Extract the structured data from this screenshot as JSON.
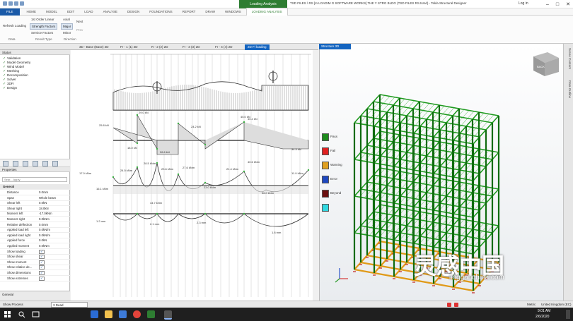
{
  "titlebar": {
    "context_tab": "Loading Analysis",
    "title": "TSD FILES \\ RS [In LOADIM G SOFTWARE WORKS] THE Y STRG BLDG (TSD FILES RS.tsmd) - Tekla Structural Designer",
    "login": "Log in",
    "minimize": "–",
    "maximize": "□",
    "close": "✕"
  },
  "ribbon_tabs": [
    "FILE",
    "HOME",
    "MODEL",
    "EDIT",
    "LOAD",
    "ANALYSE",
    "DESIGN",
    "FOUNDATIONS",
    "REPORT",
    "DRAW",
    "WINDOWS",
    "LOADING ANALYSIS"
  ],
  "ribbon": {
    "refresh": "Refresh Loading",
    "first_order": "1st Order Linear",
    "strength": "Strength Factors",
    "service": "Service Factors",
    "axial": "Axial",
    "major": "Major",
    "minor": "Minor",
    "next": "Next",
    "prev": "Prev",
    "groups": [
      "Data",
      "Result Type",
      "Direction"
    ]
  },
  "view_tabs": [
    "3D - Base (Base) 2D",
    "Fr - 1 (1) 2D",
    "R - 2 (2) 2D",
    "Fr - 3 (3) 2D",
    "Fr - 4 (4) 2D",
    "2D Fl loading"
  ],
  "status_panel": {
    "title": "Status",
    "items": [
      "Validation",
      "Model Geometry",
      "Wind Model",
      "Meshing",
      "Decomposition",
      "Solver",
      "3DFi",
      "Design"
    ]
  },
  "properties": {
    "title": "Properties",
    "search_placeholder": "Sear... Apply",
    "section": "General",
    "rows": [
      [
        "Distance",
        "0.0mm"
      ],
      [
        "Span",
        "Whole beam"
      ],
      [
        "Shear left",
        "0.0kN"
      ],
      [
        "Shear right",
        "18.0kN"
      ],
      [
        "Moment left",
        "-17.0kNm"
      ],
      [
        "Moment right",
        "0.0kNm"
      ],
      [
        "Relative deflection",
        "0.0mm"
      ],
      [
        "Applied load left",
        "0.0kN/m"
      ],
      [
        "Applied load right",
        "0.0kN/m"
      ],
      [
        "Applied force",
        "0.0kN"
      ],
      [
        "Applied moment",
        "0.0kNm"
      ],
      [
        "Show loading",
        "✓"
      ],
      [
        "Show shear",
        "✓"
      ],
      [
        "Show moment",
        "✓"
      ],
      [
        "Show relative de...",
        "✓"
      ],
      [
        "Show dimensions",
        "✓"
      ],
      [
        "Show extremes",
        "✓"
      ]
    ],
    "general_footer": "General"
  },
  "diagram_labels": {
    "shear": [
      "29.0 kN",
      "45.0 kN",
      "40.4 kN",
      "25.8 kN",
      "24.2 kN",
      "18.0 kN",
      "26.6 kN",
      "34.3 kN"
    ],
    "moment": [
      "17.0 kNm",
      "24.5 kNm",
      "28.5 kNm",
      "23.6 kNm",
      "27.6 kNm",
      "21.4 kNm",
      "40.6 kNm",
      "11.9 kNm",
      "16.1 kNm",
      "44.7 kNm",
      "23.0 kNm",
      "36.0 kNm"
    ],
    "deflection": [
      "1.2 mm",
      "2.1 mm",
      "2.3 mm",
      "1.8 mm"
    ]
  },
  "view3d": {
    "tab": "Structure 3D",
    "side_tabs": [
      "Scene Content",
      "Data Outline"
    ],
    "legend": [
      {
        "label": "Pass",
        "color": "#1e8c1e"
      },
      {
        "label": "Fail",
        "color": "#e02020"
      },
      {
        "label": "Warning",
        "color": "#e0a020"
      },
      {
        "label": "Error",
        "color": "#1e48c0"
      },
      {
        "label": "Beyond",
        "color": "#6a0f0f"
      },
      {
        "label": "",
        "color": "#30d8e0"
      }
    ],
    "cube_label": "BACK"
  },
  "statusbar": {
    "left": "Show Process",
    "field": "3 Dead",
    "units": "Metric",
    "region": "United Kingdom (EC)"
  },
  "taskbar": {
    "time": "9:01 AM",
    "date": "2/6/2020"
  },
  "watermark": {
    "text": "灵感中国",
    "url": "lingganchina.com"
  }
}
